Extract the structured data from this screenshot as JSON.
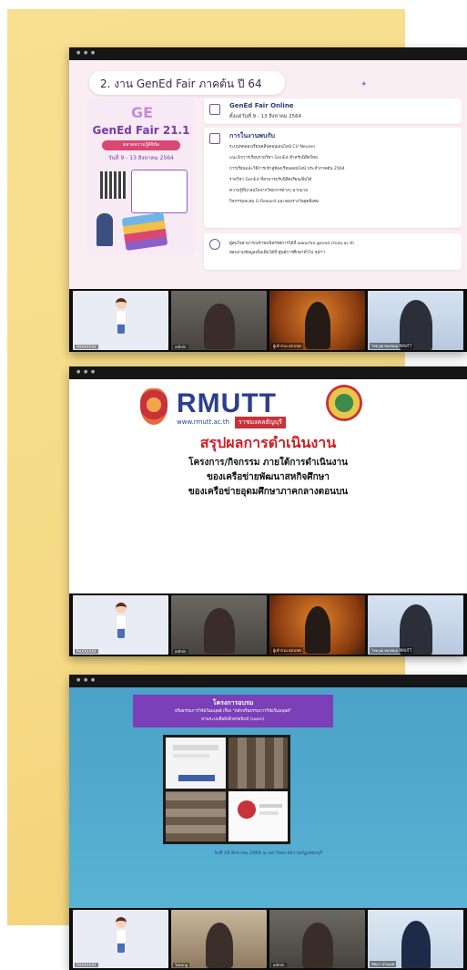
{
  "page": {
    "background": "#ffffff",
    "accent": "#f6da85"
  },
  "window_menu_icon": "three-dots-icon",
  "screens": [
    {
      "slide": {
        "title": "2. งาน GenEd Fair ภาคต้น ปี 64",
        "poster": {
          "logo": "GE",
          "heading": "GenEd Fair 21.1",
          "pill": "ตลาดความรู้ดิจิทัล",
          "date": "วันที่ 9 - 13 สิงหาคม 2564"
        },
        "card1": {
          "title": "GenEd Fair Online",
          "subtitle": "ตั้งแต่วันที่ 9 - 13 สิงหาคม 2564"
        },
        "card2": {
          "title": "การในงานพบกับ",
          "bullets": [
            "ระบบทดลองเรียนคลิปคอนเอนไลน์ CU Neuron",
            "แนะนำการเรียนรายวิชา GenEd สำหรับนิสิตใหม่",
            "การเรียนและวิธีการเข้าสู่ห้องเรียนออนไลน์ ประจำภาคต้น 2564",
            "รายวิชา GenEd ที่สามารถรับนิสิตเรียนเพิ่มได้",
            "ความรู้ที่น่าสนใจจากวิทยากรต่างๆ มากมาย",
            "กิจกรรมสะสม G-Reward และของรางวัลสุดพิเศษ"
          ]
        },
        "footer": [
          "ผู้สนใจสามารถเข้าชมนิทรรศการได้ที่ www.fair.gened.chula.ac.th",
          "สอบถามข้อมูลเพิ่มเติมได้ที่ ศูนย์การศึกษาทั่วไป จุฬาฯ"
        ]
      },
      "participants": [
        {
          "name": "PHXXXXXX",
          "type": "avatar"
        },
        {
          "name": "admin",
          "type": "person"
        },
        {
          "name": "ผู้เข้าร่วม สสวกทร",
          "type": "person"
        },
        {
          "name": "ไชยวุฒิ ทองพนม RMUTT",
          "type": "person"
        }
      ]
    },
    {
      "slide": {
        "brand": "RMUTT",
        "web": "www.rmutt.ac.th",
        "tag": "ราชมงคลธัญบุรี",
        "heading": "สรุปผลการดำเนินงาน",
        "lines": [
          "โครงการ/กิจกรรม ภายใต้การดำเนินงาน",
          "ของเครือข่ายพัฒนาสหกิจศึกษา",
          "ของเครือข่ายอุดมศึกษาภาคกลางตอนบน"
        ]
      },
      "participants": [
        {
          "name": "PHXXXXXX",
          "type": "avatar"
        },
        {
          "name": "admin",
          "type": "person"
        },
        {
          "name": "ผู้เข้าร่วม สสวกทร",
          "type": "person"
        },
        {
          "name": "ไชยวุฒิ ทองพนม RMUTT",
          "type": "person"
        }
      ]
    },
    {
      "slide": {
        "banner_title": "โครงการอบรม",
        "banner_line1": "จริยธรรมการวิจัยในมนุษย์ เรื่อง \"หลักจริยธรรมการวิจัยในมนุษย์\"",
        "banner_line2": "ผ่านระบบสื่ออิเล็กทรอนิกส์ (zoom)",
        "date_line": "วันที่ 18 สิงหาคม 2564 ณ มหาวิทยาลัยราชภัฏเพชรบุรี"
      },
      "participants": [
        {
          "name": "PHXXXXXX",
          "type": "avatar"
        },
        {
          "name": "Yukong",
          "type": "person"
        },
        {
          "name": "admin",
          "type": "person"
        },
        {
          "name": "ปัทมา ปานเมศ",
          "type": "person"
        }
      ]
    }
  ]
}
